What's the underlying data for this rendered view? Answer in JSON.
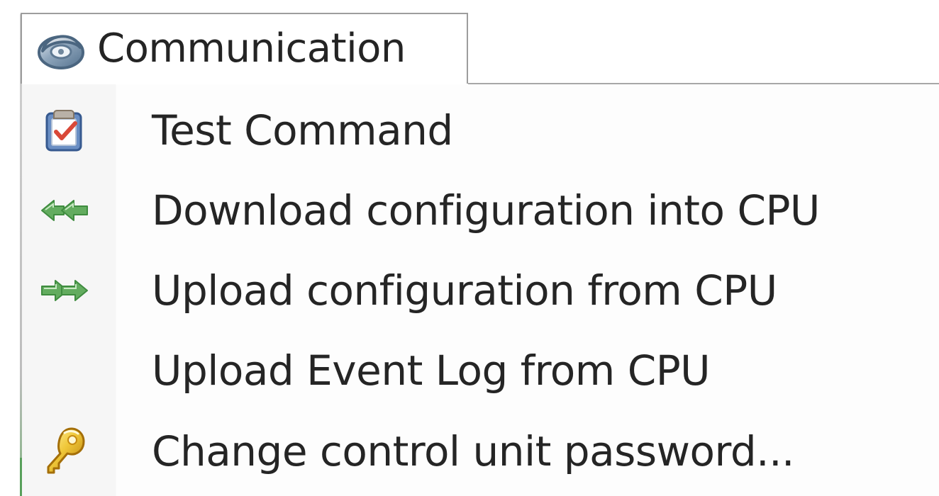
{
  "menu": {
    "tab_title": "Communication",
    "tab_icon": "phone-icon",
    "items": [
      {
        "label": "Test Command",
        "icon": "clipboard-check-icon"
      },
      {
        "label": "Download configuration into CPU",
        "icon": "green-arrows-left-icon"
      },
      {
        "label": "Upload configuration from CPU",
        "icon": "green-arrows-right-icon"
      },
      {
        "label": "Upload Event Log from CPU",
        "icon": ""
      },
      {
        "label": "Change control unit password...",
        "icon": "key-icon"
      }
    ]
  },
  "colors": {
    "text": "#252525",
    "border": "#9d9d9d",
    "green_arrow": "#4ca04c",
    "key": "#e0b425",
    "clipboard_check": "#d94838"
  }
}
